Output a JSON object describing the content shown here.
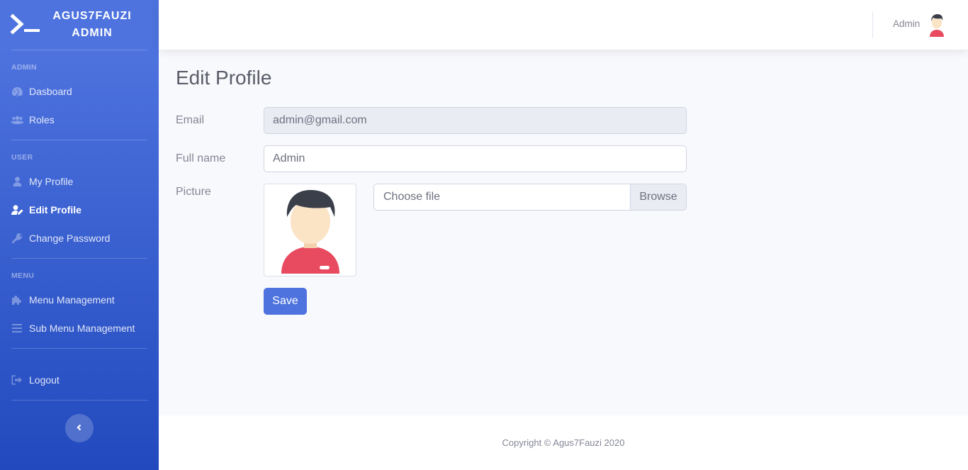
{
  "brand": {
    "line1": "AGUS7FAUZI",
    "line2": "ADMIN",
    "icon": "terminal-icon"
  },
  "sidebar": {
    "sections": [
      {
        "heading": "ADMIN"
      },
      {
        "heading": "USER"
      },
      {
        "heading": "MENU"
      }
    ],
    "items": [
      {
        "label": "Dasboard",
        "icon": "tachometer-icon"
      },
      {
        "label": "Roles",
        "icon": "users-icon"
      },
      {
        "label": "My Profile",
        "icon": "user-icon"
      },
      {
        "label": "Edit Profile",
        "icon": "user-edit-icon",
        "active": true
      },
      {
        "label": "Change Password",
        "icon": "key-icon"
      },
      {
        "label": "Menu Management",
        "icon": "puzzle-icon"
      },
      {
        "label": "Sub Menu Management",
        "icon": "bars-icon"
      },
      {
        "label": "Logout",
        "icon": "sign-out-icon"
      }
    ],
    "toggle_icon": "chevron-left-icon"
  },
  "topbar": {
    "user_name": "Admin",
    "avatar_icon": "avatar-icon"
  },
  "page": {
    "title": "Edit Profile",
    "email_label": "Email",
    "email_value": "admin@gmail.com",
    "name_label": "Full name",
    "name_value": "Admin",
    "picture_label": "Picture",
    "file_placeholder": "Choose file",
    "browse_label": "Browse",
    "save_label": "Save"
  },
  "footer": {
    "copyright": "Copyright © Agus7Fauzi 2020"
  },
  "colors": {
    "primary": "#4e73df",
    "primary_dark": "#224abe",
    "avatar_shirt": "#e84a5f",
    "avatar_hair": "#3b3f4a",
    "avatar_skin": "#fbe3c6"
  }
}
